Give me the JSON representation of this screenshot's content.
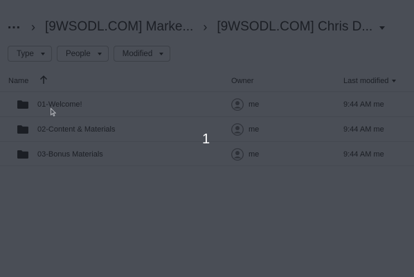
{
  "breadcrumb": {
    "more": "…",
    "separator": "›",
    "items": [
      "[9WSODL.COM] Marke...",
      "[9WSODL.COM] Chris D..."
    ]
  },
  "filters": [
    {
      "label": "Type"
    },
    {
      "label": "People"
    },
    {
      "label": "Modified"
    }
  ],
  "table": {
    "columns": {
      "name": "Name",
      "owner": "Owner",
      "modified": "Last modified"
    },
    "rows": [
      {
        "name": "01-Welcome!",
        "owner": "me",
        "modified": "9:44 AM me"
      },
      {
        "name": "02-Content & Materials",
        "owner": "me",
        "modified": "9:44 AM me"
      },
      {
        "name": "03-Bonus Materials",
        "owner": "me",
        "modified": "9:44 AM me"
      }
    ]
  },
  "overlay": {
    "step_number": "1"
  },
  "colors": {
    "background": "#4a4e56",
    "text": "#1b1e24",
    "overlay_text": "#ffffff"
  }
}
